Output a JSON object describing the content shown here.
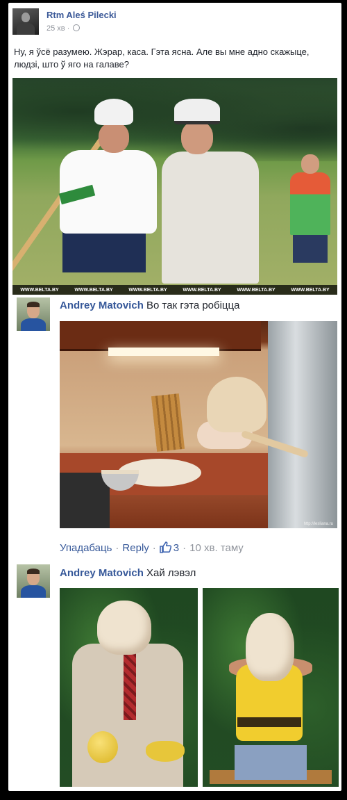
{
  "post": {
    "author": "Rtm Aleś Pilecki",
    "time": "25 хв",
    "text": "Ну, я ўсё разумею. Жэрар, каса. Гэта ясна. Але вы мне адно скажыце, людзі, што ў яго на галаве?",
    "photo_watermark": "WWW.BELTA.BY"
  },
  "comments": [
    {
      "author": "Andrey Matovich",
      "text": "Во так гэта робіцца",
      "image_watermark": "http://lesliana.ru",
      "actions": {
        "unlike": "Упадабаць",
        "reply": "Reply",
        "likes": "3",
        "time": "10 хв. таму"
      }
    },
    {
      "author": "Andrey Matovich",
      "text": "Хай лэвэл"
    }
  ],
  "icons": {
    "privacy": "globe-icon",
    "like": "thumbs-up-icon"
  },
  "colors": {
    "link": "#365899",
    "meta": "#90949c",
    "like_icon": "#4267b2"
  }
}
